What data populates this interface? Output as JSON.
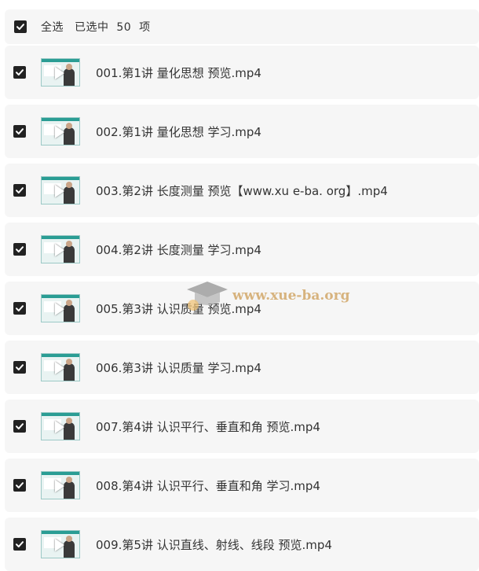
{
  "header": {
    "select_all_label": "全选",
    "selected_text": "已选中  50  项",
    "checked": true
  },
  "files": [
    {
      "name": "001.第1讲 量化思想 预览.mp4",
      "checked": true
    },
    {
      "name": "002.第1讲 量化思想 学习.mp4",
      "checked": true
    },
    {
      "name": "003.第2讲 长度测量 预览【www.xu e-ba. org】.mp4",
      "checked": true
    },
    {
      "name": "004.第2讲 长度测量 学习.mp4",
      "checked": true
    },
    {
      "name": "005.第3讲 认识质量 预览.mp4",
      "checked": true
    },
    {
      "name": "006.第3讲 认识质量 学习.mp4",
      "checked": true
    },
    {
      "name": "007.第4讲 认识平行、垂直和角 预览.mp4",
      "checked": true
    },
    {
      "name": "008.第4讲 认识平行、垂直和角 学习.mp4",
      "checked": true
    },
    {
      "name": "009.第5讲 认识直线、射线、线段 预览.mp4",
      "checked": true
    }
  ],
  "watermark": {
    "text": "www.xue-ba.org",
    "icon": "graduation-cap-icon"
  },
  "colors": {
    "row_bg": "#f6f6f6",
    "checkbox": "#222222",
    "text": "#333333",
    "thumb_accent": "#2a9d94",
    "watermark": "#d2a86a"
  }
}
